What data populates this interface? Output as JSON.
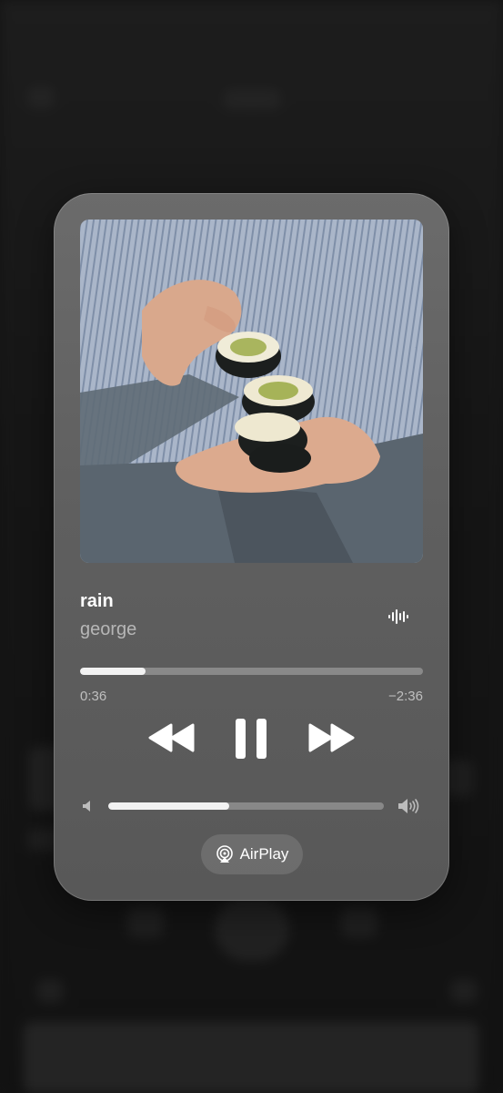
{
  "now_playing": {
    "title": "rain",
    "artist": "george",
    "progress": 0.19,
    "elapsed": "0:36",
    "remaining": "−2:36"
  },
  "volume": {
    "level": 0.44
  },
  "airplay": {
    "label": "AirPlay"
  },
  "icons": {
    "wave": "waveform-icon",
    "rewind": "rewind-icon",
    "pause": "pause-icon",
    "forward": "fast-forward-icon",
    "vol_low": "speaker-low-icon",
    "vol_high": "speaker-high-icon",
    "airplay": "airplay-icon"
  },
  "colors": {
    "card": "#636363",
    "fill": "#f2f2f2"
  }
}
